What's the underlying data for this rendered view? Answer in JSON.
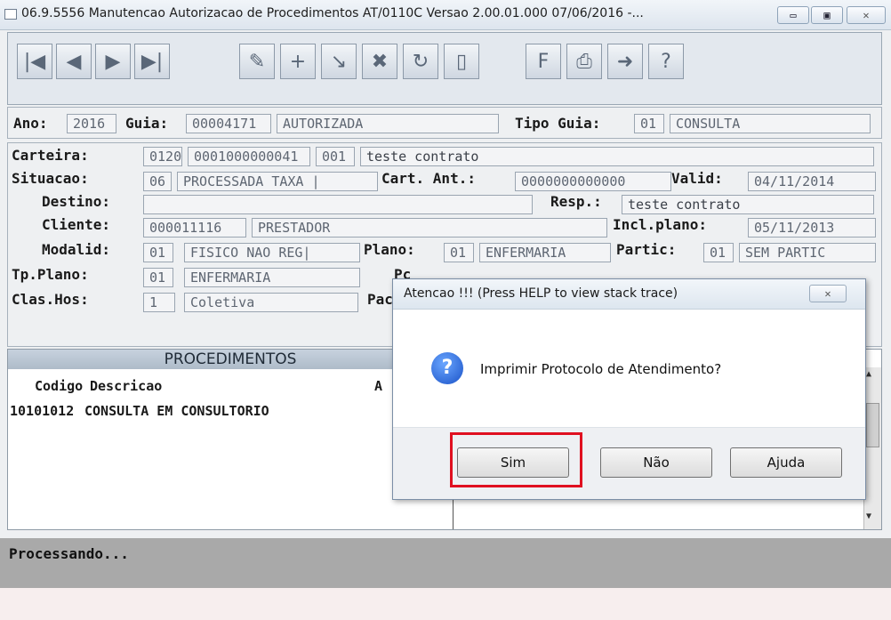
{
  "window": {
    "title": "06.9.5556 Manutencao Autorizacao de Procedimentos AT/0110C Versao 2.00.01.000 07/06/2016 -...",
    "min_icon": "minimize-icon",
    "max_icon": "maximize-icon",
    "close_symbol": "✕"
  },
  "toolbar": {
    "buttons": [
      {
        "icon": "first-record-icon",
        "glyph": "|◀"
      },
      {
        "icon": "previous-record-icon",
        "glyph": "◀"
      },
      {
        "icon": "next-record-icon",
        "glyph": "▶"
      },
      {
        "icon": "last-record-icon",
        "glyph": "▶|"
      },
      {
        "icon": "edit-icon",
        "glyph": "✎"
      },
      {
        "icon": "add-icon",
        "glyph": "+"
      },
      {
        "icon": "modify-icon",
        "glyph": "↘"
      },
      {
        "icon": "delete-icon",
        "glyph": "✖"
      },
      {
        "icon": "refresh-icon",
        "glyph": "↻"
      },
      {
        "icon": "exit-door-icon",
        "glyph": "▯"
      },
      {
        "icon": "filter-icon",
        "glyph": "F"
      },
      {
        "icon": "print-icon",
        "glyph": "⎙"
      },
      {
        "icon": "export-icon",
        "glyph": "➜"
      },
      {
        "icon": "help-icon",
        "glyph": "?"
      }
    ]
  },
  "header": {
    "ano_label": "Ano:",
    "ano": "2016",
    "guia_label": "Guia:",
    "guia": "00004171",
    "guia_status": "AUTORIZADA",
    "tipo_label": "Tipo Guia:",
    "tipo_code": "01",
    "tipo_desc": "CONSULTA"
  },
  "details": {
    "carteira_label": "Carteira:",
    "carteira_1": "0120",
    "carteira_2": "0001000000041",
    "carteira_3": "001",
    "carteira_nome": "teste contrato",
    "situacao_label": "Situacao:",
    "situacao_code": "06",
    "situacao_desc": "PROCESSADA TAXA |",
    "cartant_label": "Cart. Ant.:",
    "cartant": "0000000000000",
    "valid_label": "Valid:",
    "valid": "04/11/2014",
    "destino_label": "Destino:",
    "destino": "",
    "resp_label": "Resp.:",
    "resp": "teste contrato",
    "cliente_label": "Cliente:",
    "cliente_code": "000011116",
    "cliente_desc": "PRESTADOR",
    "inclplano_label": "Incl.plano:",
    "inclplano": "05/11/2013",
    "modalid_label": "Modalid:",
    "modalid_code": "01",
    "modalid_desc": "FISICO NAO REG|",
    "plano_label": "Plano:",
    "plano_code": "01",
    "plano_desc": "ENFERMARIA",
    "partic_label": "Partic:",
    "partic_code": "01",
    "partic_desc": "SEM PARTIC",
    "tpplano_label": "Tp.Plano:",
    "tpplano_code": "01",
    "tpplano_desc": "ENFERMARIA",
    "pc_label": "Pc",
    "claslhos_label": "Clas.Hos:",
    "claslhos_code": "1",
    "claslhos_desc": "Coletiva",
    "pac_label": "Pac"
  },
  "procedimentos": {
    "title": "PROCEDIMENTOS",
    "col_codigo": "Codigo",
    "col_descricao": "Descricao",
    "col_extra": "A",
    "rows": [
      {
        "codigo": "10101012",
        "descricao": "CONSULTA EM CONSULTORIO"
      }
    ]
  },
  "status": {
    "text": "Processando..."
  },
  "dialog": {
    "title": "Atencao !!!  (Press HELP to view stack trace)",
    "icon": "question-icon",
    "message": "Imprimir Protocolo de Atendimento?",
    "buttons": {
      "sim": "Sim",
      "nao": "Não",
      "ajuda": "Ajuda"
    },
    "close_symbol": "✕"
  },
  "colors": {
    "highlight": "#e01020",
    "status_bar": "#a9a9a9",
    "question_icon": "#1a52c7"
  }
}
